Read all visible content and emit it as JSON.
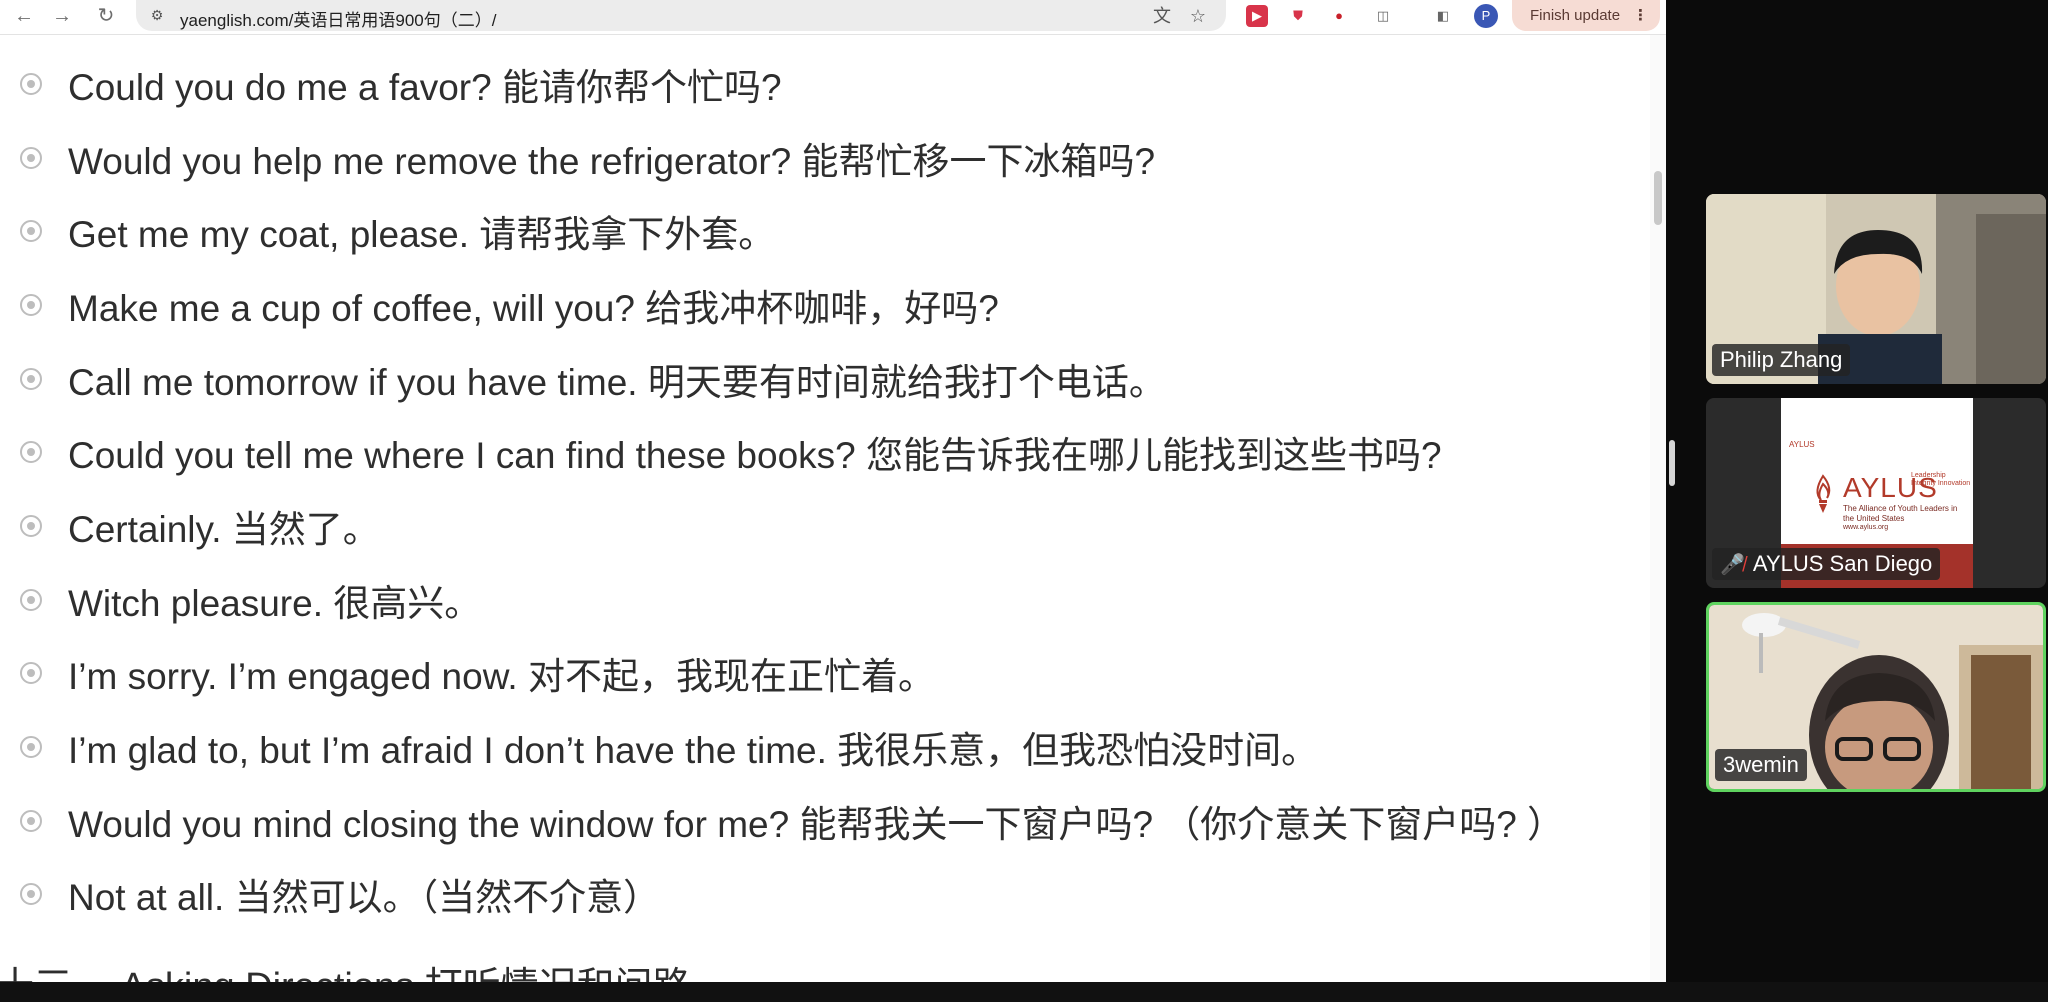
{
  "browser": {
    "url": "yaenglish.com/英语日常用语900句（二）/",
    "finish_update_label": "Finish update",
    "profile_initial": "P"
  },
  "phrases": [
    "Could you do me a favor? 能请你帮个忙吗?",
    "Would you help me remove the refrigerator? 能帮忙移一下冰箱吗?",
    "Get me my coat, please. 请帮我拿下外套。",
    "Make me a cup of coffee, will you? 给我冲杯咖啡，好吗?",
    "Call me tomorrow if you have time. 明天要有时间就给我打个电话。",
    "Could you tell me where I can find these books? 您能告诉我在哪儿能找到这些书吗?",
    "Certainly. 当然了。",
    "Witch pleasure. 很高兴。",
    "I’m sorry. I’m engaged now. 对不起，我现在正忙着。",
    "I’m glad to, but I’m afraid I don’t have the time. 我很乐意，但我恐怕没时间。",
    "Would you mind closing the window for me? 能帮我关一下窗户吗? （你介意关下窗户吗? ）",
    "Not at all. 当然可以。（当然不介意）"
  ],
  "section_heading": "十三、 Asking Directions 打听情况和问路",
  "participants": [
    {
      "name": "Philip Zhang",
      "muted": false,
      "active": false
    },
    {
      "name": "AYLUS San Diego",
      "muted": true,
      "active": false
    },
    {
      "name": "3wemin",
      "muted": false,
      "active": true
    }
  ],
  "aylus_card": {
    "small": "AYLUS",
    "title": "AYLUS",
    "tagline": "Leadership Integrity Innovation",
    "subtitle": "The Alliance of Youth Leaders in the United States",
    "website": "www.aylus.org"
  },
  "colors": {
    "active_speaker_border": "#5fd35f",
    "muted_mic": "#e0403a",
    "aylus_red": "#a4322a"
  }
}
